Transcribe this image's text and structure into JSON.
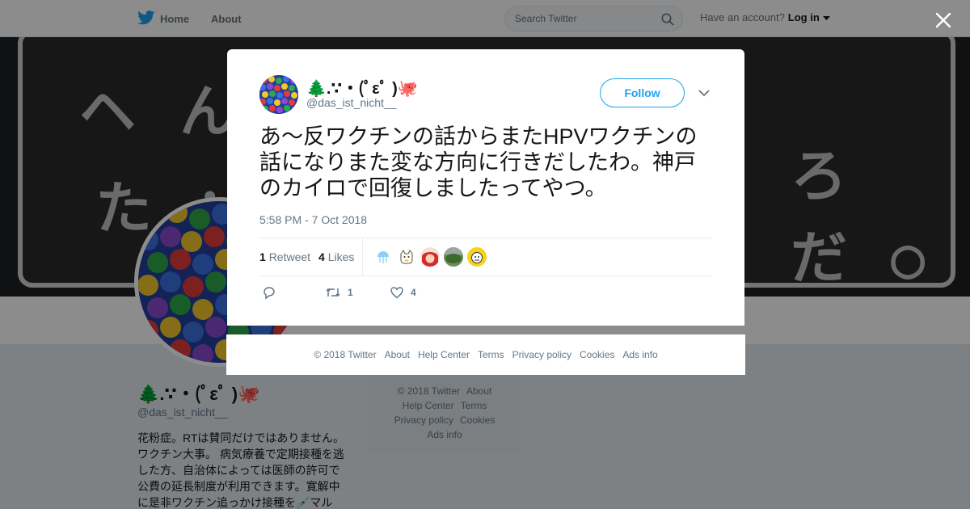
{
  "nav": {
    "home_label": "Home",
    "about_label": "About",
    "search_placeholder": "Search Twitter",
    "account_prompt": "Have an account?",
    "login_label": "Log in",
    "brand_color": "#1da1f2"
  },
  "profile": {
    "display_name": "🌲.∵・(ﾟεﾟ )🐙",
    "handle": "@das_ist_nicht__",
    "bio": "花粉症。RTは賛同だけではありません。ワクチン大事。 病気療養で定期接種を逃した方、自治体によっては医師の許可で公費の延長制度が利用できます。寛解中に是非ワクチン追っかけ接種を💉マル"
  },
  "side_footer": {
    "copyright": "© 2018 Twitter",
    "about": "About",
    "help_center": "Help Center",
    "terms": "Terms",
    "privacy": "Privacy policy",
    "cookies": "Cookies",
    "ads_info": "Ads info"
  },
  "tweet": {
    "display_name": "🌲.∵・(ﾟεﾟ )🐙",
    "handle": "@das_ist_nicht__",
    "follow_label": "Follow",
    "text": "あ～反ワクチンの話からまたHPVワクチンの話になりまた変な方向に行きだしたわ。神戸のカイロで回復しましたってやつ。",
    "timestamp": "5:58 PM - 7 Oct 2018",
    "retweet_count": "1",
    "retweet_label": "Retweet",
    "like_count": "4",
    "likes_label": "Likes",
    "likers": [
      "jellyfish-avatar",
      "cat-avatar",
      "red-anime-avatar",
      "landscape-avatar",
      "yellow-cartoon-avatar"
    ],
    "action_retweet_count": "1",
    "action_like_count": "4"
  },
  "modal_footer": {
    "copyright": "© 2018 Twitter",
    "about": "About",
    "help_center": "Help Center",
    "terms": "Terms",
    "privacy": "Privacy policy",
    "cookies": "Cookies",
    "ads_info": "Ads info"
  }
}
